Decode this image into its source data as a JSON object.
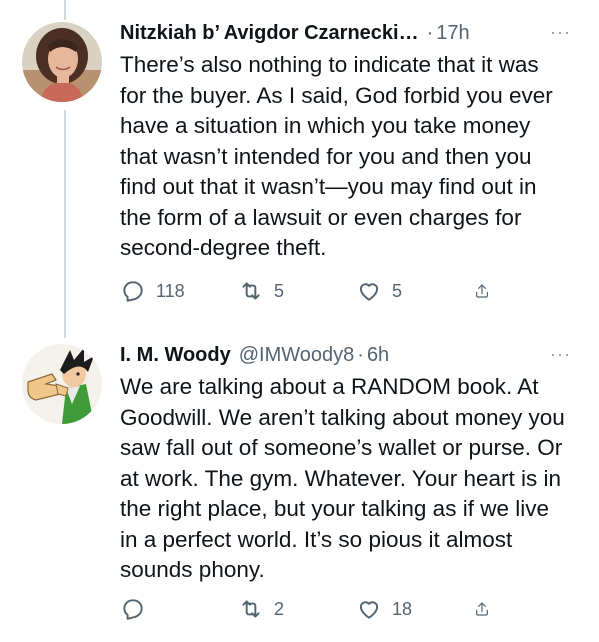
{
  "tweets": [
    {
      "display_name": "Nitzkiah b’ Avigdor Czarnecki…",
      "handle": "",
      "separator": "·",
      "time": "17h",
      "more": "···",
      "text": "There’s also nothing to indicate that it was for the buyer. As I said, God forbid you ever have a situation in which you take money that wasn’t intended for you and then you find out that it wasn’t—you may find out in the form of a lawsuit or even charges for second-degree theft.",
      "replies": "118",
      "retweets": "5",
      "likes": "5"
    },
    {
      "display_name": "I. M. Woody",
      "handle": "@IMWoody8",
      "separator": "·",
      "time": "6h",
      "more": "···",
      "text": "We are talking about a RANDOM book. At Goodwill. We aren’t talking about money you saw fall out of someone’s wallet or purse. Or at work. The gym. Whatever. Your heart is in the right place, but your talking as if we live in a perfect world. It’s so pious it almost sounds phony.",
      "replies": "",
      "retweets": "2",
      "likes": "18"
    }
  ],
  "icons": {
    "reply": "reply-icon",
    "retweet": "retweet-icon",
    "like": "like-icon",
    "share": "share-icon",
    "more": "more-icon"
  },
  "colors": {
    "text": "#0f1419",
    "secondary": "#536471",
    "thread_line": "#cfd9de"
  }
}
